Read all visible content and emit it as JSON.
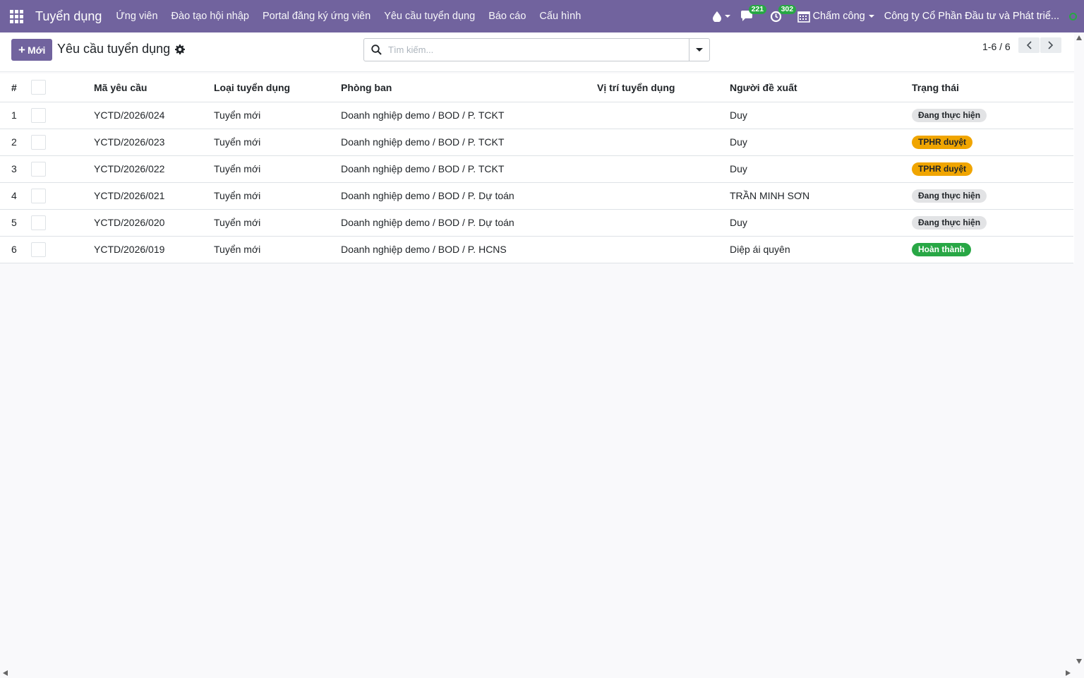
{
  "app": {
    "title": "Tuyển dụng",
    "menu": [
      "Ứng viên",
      "Đào tạo hội nhập",
      "Portal đăng ký ứng viên",
      "Yêu cầu tuyển dụng",
      "Báo cáo",
      "Cấu hình"
    ]
  },
  "systray": {
    "messages_count": "221",
    "activities_count": "302",
    "attendance_label": "Chấm công",
    "company": "Công ty Cổ Phần Đầu tư và Phát triể..."
  },
  "control": {
    "new_label": "Mới",
    "breadcrumb": "Yêu cầu tuyển dụng",
    "search_placeholder": "Tìm kiếm...",
    "pager": "1-6 / 6"
  },
  "table": {
    "headers": {
      "num": "#",
      "code": "Mã yêu cầu",
      "type": "Loại tuyển dụng",
      "department": "Phòng ban",
      "position": "Vị trí tuyển dụng",
      "proposer": "Người đề xuất",
      "status": "Trạng thái"
    },
    "rows": [
      {
        "num": "1",
        "code": "YCTD/2026/024",
        "type": "Tuyển mới",
        "department": "Doanh nghiệp demo / BOD / P. TCKT",
        "position": "",
        "proposer": "Duy",
        "status": "Đang thực hiện",
        "status_kind": "progress"
      },
      {
        "num": "2",
        "code": "YCTD/2026/023",
        "type": "Tuyển mới",
        "department": "Doanh nghiệp demo / BOD / P. TCKT",
        "position": "",
        "proposer": "Duy",
        "status": "TPHR duyệt",
        "status_kind": "approve"
      },
      {
        "num": "3",
        "code": "YCTD/2026/022",
        "type": "Tuyển mới",
        "department": "Doanh nghiệp demo / BOD / P. TCKT",
        "position": "",
        "proposer": "Duy",
        "status": "TPHR duyệt",
        "status_kind": "approve"
      },
      {
        "num": "4",
        "code": "YCTD/2026/021",
        "type": "Tuyển mới",
        "department": "Doanh nghiệp demo / BOD / P. Dự toán",
        "position": "",
        "proposer": "TRẦN MINH SƠN",
        "status": "Đang thực hiện",
        "status_kind": "progress"
      },
      {
        "num": "5",
        "code": "YCTD/2026/020",
        "type": "Tuyển mới",
        "department": "Doanh nghiệp demo / BOD / P. Dự toán",
        "position": "",
        "proposer": "Duy",
        "status": "Đang thực hiện",
        "status_kind": "progress"
      },
      {
        "num": "6",
        "code": "YCTD/2026/019",
        "type": "Tuyển mới",
        "department": "Doanh nghiệp demo / BOD / P. HCNS",
        "position": "",
        "proposer": "Diệp ái quyên",
        "status": "Hoàn thành",
        "status_kind": "done"
      }
    ]
  },
  "colors": {
    "brand": "#71639e",
    "status_progress_bg": "#e2e3e5",
    "status_approve_bg": "#f0a500",
    "status_done_bg": "#28a745"
  }
}
